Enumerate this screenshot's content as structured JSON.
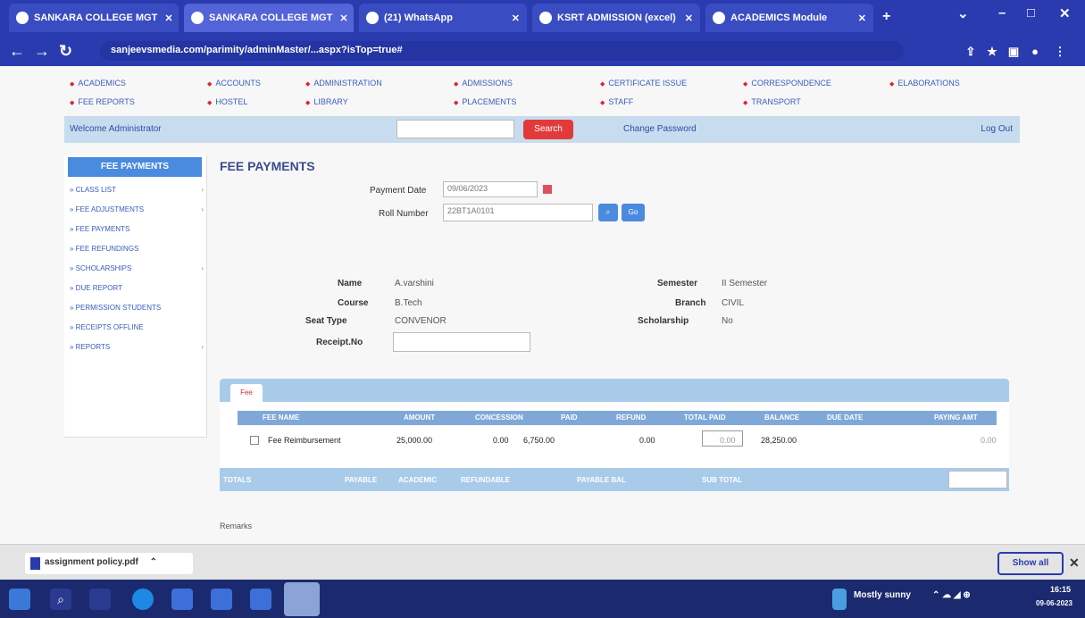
{
  "browser": {
    "tabs": [
      {
        "label": "SANKARA COLLEGE MGT",
        "active": false
      },
      {
        "label": "SANKARA COLLEGE MGT",
        "active": true
      },
      {
        "label": "(21) WhatsApp",
        "active": false
      },
      {
        "label": "KSRT ADMISSION (excel)",
        "active": false
      },
      {
        "label": "ACADEMICS Module",
        "active": false
      }
    ],
    "url": "sanjeevsmedia.com/parimity/adminMaster/...aspx?isTop=true#"
  },
  "menu": {
    "row1": [
      "ACADEMICS",
      "ACCOUNTS",
      "ADMINISTRATION",
      "ADMISSIONS",
      "CERTIFICATE ISSUE",
      "CORRESPONDENCE",
      "ELABORATIONS"
    ],
    "row2": [
      "FEE REPORTS",
      "HOSTEL",
      "LIBRARY",
      "PLACEMENTS",
      "STAFF",
      "TRANSPORT"
    ]
  },
  "topbar": {
    "welcome": "Welcome Administrator",
    "search_label": "Search",
    "change_password": "Change Password",
    "logout": "Log Out"
  },
  "sidebar": {
    "heading": "FEE PAYMENTS",
    "items": [
      {
        "label": "CLASS LIST",
        "has_chevron": true
      },
      {
        "label": "FEE ADJUSTMENTS",
        "has_chevron": true
      },
      {
        "label": "FEE PAYMENTS",
        "has_chevron": false
      },
      {
        "label": "FEE REFUNDINGS",
        "has_chevron": false
      },
      {
        "label": "SCHOLARSHIPS",
        "has_chevron": true
      },
      {
        "label": "DUE REPORT",
        "has_chevron": false
      },
      {
        "label": "PERMISSION STUDENTS",
        "has_chevron": false
      },
      {
        "label": "RECEIPTS OFFLINE",
        "has_chevron": false
      },
      {
        "label": "REPORTS",
        "has_chevron": true
      }
    ]
  },
  "form": {
    "title": "FEE PAYMENTS",
    "payment_date_label": "Payment Date",
    "payment_date": "09/06/2023",
    "roll_number_label": "Roll Number",
    "roll_number": "22BT1A0101",
    "go_label": "Go"
  },
  "student": {
    "name_label": "Name",
    "name": "A.varshini",
    "course_label": "Course",
    "course": "B.Tech",
    "seat_type_label": "Seat Type",
    "seat_type": "CONVENOR",
    "receipt_no_label": "Receipt.No",
    "semester_label": "Semester",
    "semester": "II Semester",
    "branch_label": "Branch",
    "branch": "CIVIL",
    "scholarship_label": "Scholarship",
    "scholarship": "No"
  },
  "fee_table": {
    "tab_label": "Fee",
    "headers": [
      "FEE NAME",
      "AMOUNT",
      "CONCESSION",
      "PAID",
      "REFUND",
      "TOTAL PAID",
      "BALANCE",
      "DUE DATE",
      "PAYING AMT"
    ],
    "rows": [
      {
        "name": "Fee Reimbursement",
        "amount": "25,000.00",
        "concession": "0.00",
        "paid": "6,750.00",
        "refund": "0.00",
        "conc_input": "0.00",
        "balance": "28,250.00",
        "paying": "0.00"
      }
    ],
    "footer": [
      "TOTALS",
      "PAYABLE",
      "ACADEMIC",
      "REFUNDABLE",
      "PAYABLE BAL",
      "SUB TOTAL"
    ]
  },
  "remarks_label": "Remarks",
  "downloads": {
    "file": "assignment policy.pdf",
    "show_all": "Show all"
  },
  "taskbar": {
    "tray_text": "Mostly sunny",
    "time": "16:15",
    "date": "09-06-2023"
  },
  "colors": {
    "chrome": "#2a3bb0",
    "accent": "#4a8be0",
    "search_button": "#e23a3a",
    "panel": "#a9cbea"
  }
}
